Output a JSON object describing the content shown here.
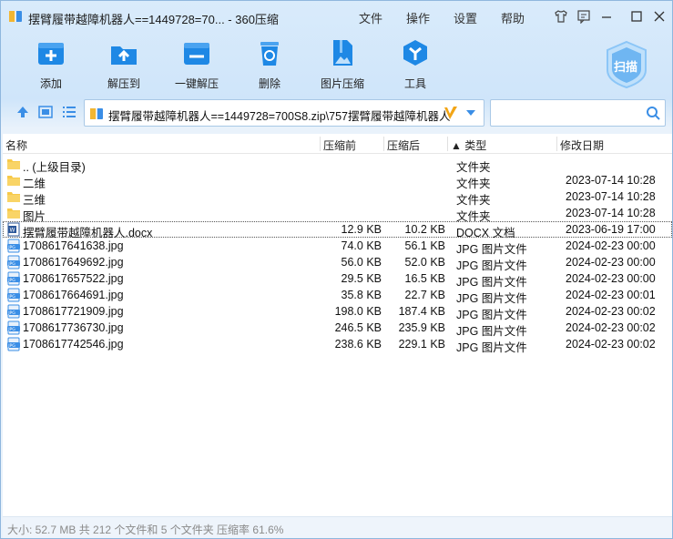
{
  "window": {
    "title": "摆臂履带越障机器人==1449728=70... - 360压缩",
    "menu": [
      "文件",
      "操作",
      "设置",
      "帮助"
    ]
  },
  "toolbar": {
    "items": [
      {
        "label": "添加",
        "icon": "add-icon"
      },
      {
        "label": "解压到",
        "icon": "extract-to-icon"
      },
      {
        "label": "一键解压",
        "icon": "one-click-extract-icon"
      },
      {
        "label": "删除",
        "icon": "delete-icon"
      },
      {
        "label": "图片压缩",
        "icon": "image-compress-icon"
      },
      {
        "label": "工具",
        "icon": "tools-icon"
      }
    ],
    "scan_label": "扫描"
  },
  "address": {
    "path": "摆臂履带越障机器人==1449728=700S8.zip\\757摆臂履带越障机器人",
    "search_placeholder": ""
  },
  "columns": {
    "name": "名称",
    "compressed": "压缩前",
    "after": "压缩后",
    "type": "▲ 类型",
    "modified": "修改日期"
  },
  "files": [
    {
      "name": ".. (上级目录)",
      "before": "",
      "after": "",
      "type": "文件夹",
      "date": "",
      "icon": "folder"
    },
    {
      "name": "二维",
      "before": "",
      "after": "",
      "type": "文件夹",
      "date": "2023-07-14 10:28",
      "icon": "folder"
    },
    {
      "name": "三维",
      "before": "",
      "after": "",
      "type": "文件夹",
      "date": "2023-07-14 10:28",
      "icon": "folder"
    },
    {
      "name": "图片",
      "before": "",
      "after": "",
      "type": "文件夹",
      "date": "2023-07-14 10:28",
      "icon": "folder"
    },
    {
      "name": "摆臂履带越障机器人.docx",
      "before": "12.9 KB",
      "after": "10.2 KB",
      "type": "DOCX 文档",
      "date": "2023-06-19 17:00",
      "icon": "docx"
    },
    {
      "name": "1708617641638.jpg",
      "before": "74.0 KB",
      "after": "56.1 KB",
      "type": "JPG 图片文件",
      "date": "2024-02-23 00:00",
      "icon": "jpg"
    },
    {
      "name": "1708617649692.jpg",
      "before": "56.0 KB",
      "after": "52.0 KB",
      "type": "JPG 图片文件",
      "date": "2024-02-23 00:00",
      "icon": "jpg"
    },
    {
      "name": "1708617657522.jpg",
      "before": "29.5 KB",
      "after": "16.5 KB",
      "type": "JPG 图片文件",
      "date": "2024-02-23 00:00",
      "icon": "jpg"
    },
    {
      "name": "1708617664691.jpg",
      "before": "35.8 KB",
      "after": "22.7 KB",
      "type": "JPG 图片文件",
      "date": "2024-02-23 00:01",
      "icon": "jpg"
    },
    {
      "name": "1708617721909.jpg",
      "before": "198.0 KB",
      "after": "187.4 KB",
      "type": "JPG 图片文件",
      "date": "2024-02-23 00:02",
      "icon": "jpg"
    },
    {
      "name": "1708617736730.jpg",
      "before": "246.5 KB",
      "after": "235.9 KB",
      "type": "JPG 图片文件",
      "date": "2024-02-23 00:02",
      "icon": "jpg"
    },
    {
      "name": "1708617742546.jpg",
      "before": "238.6 KB",
      "after": "229.1 KB",
      "type": "JPG 图片文件",
      "date": "2024-02-23 00:02",
      "icon": "jpg"
    }
  ],
  "status": "大小: 52.7 MB 共 212 个文件和 5 个文件夹 压缩率 61.6%",
  "colors": {
    "accent": "#1e88e5",
    "folder": "#f7c948",
    "selection_text": "#111111"
  }
}
